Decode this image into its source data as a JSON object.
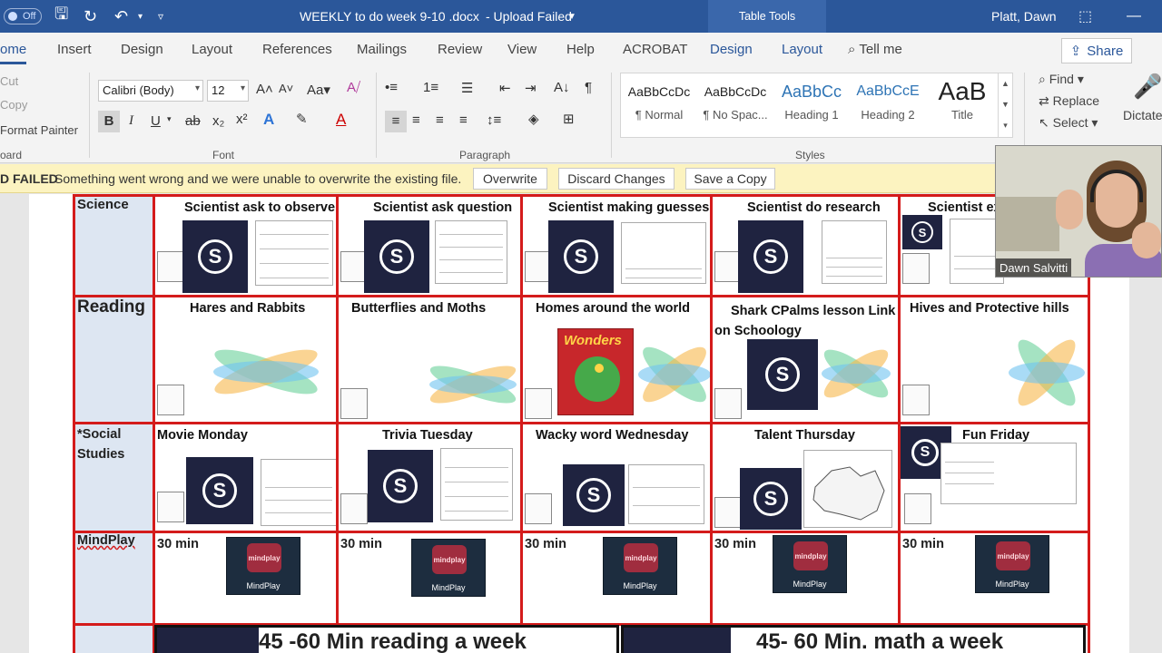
{
  "titlebar": {
    "autosave": "Off",
    "doc_title": "WEEKLY to do week 9-10 .docx",
    "upload_status": "-  Upload Failed",
    "table_tools": "Table Tools",
    "user_name": "Platt, Dawn"
  },
  "tabs": {
    "home": "ome",
    "insert": "Insert",
    "design": "Design",
    "layout": "Layout",
    "references": "References",
    "mailings": "Mailings",
    "review": "Review",
    "view": "View",
    "help": "Help",
    "acrobat": "ACROBAT",
    "table_design": "Design",
    "table_layout": "Layout",
    "tell_me": "Tell me",
    "share": "Share"
  },
  "ribbon": {
    "cut": "Cut",
    "copy": "Copy",
    "format_painter": "Format Painter",
    "clipboard": "oard",
    "font_name": "Calibri (Body)",
    "font_size": "12",
    "font_group": "Font",
    "paragraph_group": "Paragraph",
    "styles_group": "Styles",
    "styles": [
      {
        "preview": "AaBbCcDc",
        "name": "¶ Normal"
      },
      {
        "preview": "AaBbCcDc",
        "name": "¶ No Spac..."
      },
      {
        "preview": "AaBbCc",
        "name": "Heading 1"
      },
      {
        "preview": "AaBbCcE",
        "name": "Heading 2"
      },
      {
        "preview": "AaB",
        "name": "Title"
      }
    ],
    "find": "Find",
    "replace": "Replace",
    "select": "Select",
    "dictate": "Dictate"
  },
  "msgbar": {
    "head": "D FAILED",
    "text": "Something went wrong and we were unable to overwrite the existing file.",
    "overwrite": "Overwrite",
    "discard": "Discard Changes",
    "save_copy": "Save a Copy"
  },
  "grid": {
    "subjects": [
      "Science",
      "Reading",
      "*Social Studies",
      "MindPlay"
    ],
    "science": [
      "Scientist ask to observe",
      "Scientist ask question",
      "Scientist making guesses",
      "Scientist do research",
      "Scientist ex"
    ],
    "reading": [
      "Hares and Rabbits",
      "Butterflies and Moths",
      "Homes around the world",
      "Shark CPalms lesson Link on Schoology",
      "Hives and Protective hills"
    ],
    "social": [
      "Movie Monday",
      "Trivia Tuesday",
      "Wacky word Wednesday",
      "Talent Thursday",
      "Fun Friday"
    ],
    "mindplay_time": "30 min",
    "mindplay_tile": "mindplay",
    "mindplay_label": "MindPlay",
    "wonders": "Wonders",
    "banner_reading": "45 -60 Min reading a week",
    "banner_math": "45- 60 Min. math a week"
  },
  "webcam": {
    "name": "Dawn Salvitti"
  },
  "colors": {
    "word_blue": "#2b579a",
    "table_red": "#d41b1b",
    "msgbar_yellow": "#fcf3c0"
  }
}
